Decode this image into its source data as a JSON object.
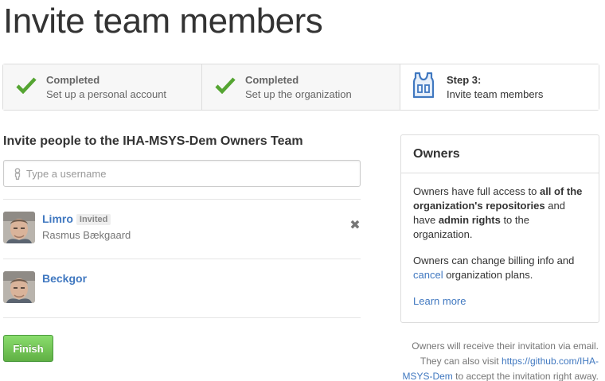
{
  "page": {
    "title": "Invite team members"
  },
  "steps": [
    {
      "title": "Completed",
      "desc": "Set up a personal account",
      "icon": "checkmark-icon"
    },
    {
      "title": "Completed",
      "desc": "Set up the organization",
      "icon": "checkmark-icon"
    },
    {
      "title": "Step 3:",
      "desc": "Invite team members",
      "icon": "jersey-icon"
    }
  ],
  "invite": {
    "heading": "Invite people to the IHA-MSYS-Dem Owners Team",
    "placeholder": "Type a username",
    "value": ""
  },
  "members": [
    {
      "username": "Limro",
      "badge": "Invited",
      "full_name": "Rasmus Bækgaard",
      "removable": true
    },
    {
      "username": "Beckgor"
    }
  ],
  "finish_label": "Finish",
  "owners": {
    "title": "Owners",
    "p1_a": "Owners have full access to ",
    "p1_b": "all of the organization's repositories",
    "p1_c": " and have ",
    "p1_d": "admin rights",
    "p1_e": " to the organization.",
    "p2_a": "Owners can change billing info and ",
    "p2_link": "cancel",
    "p2_b": " organization plans.",
    "learn_more": "Learn more"
  },
  "notice": {
    "a": "Owners will receive their invitation via email. They can also visit ",
    "link": "https://github.com/IHA-MSYS-Dem",
    "b": " to accept the invitation right away."
  },
  "colors": {
    "link": "#4078c0",
    "check": "#55a532",
    "finish": "#60b044",
    "jersey": "#4078c0"
  }
}
